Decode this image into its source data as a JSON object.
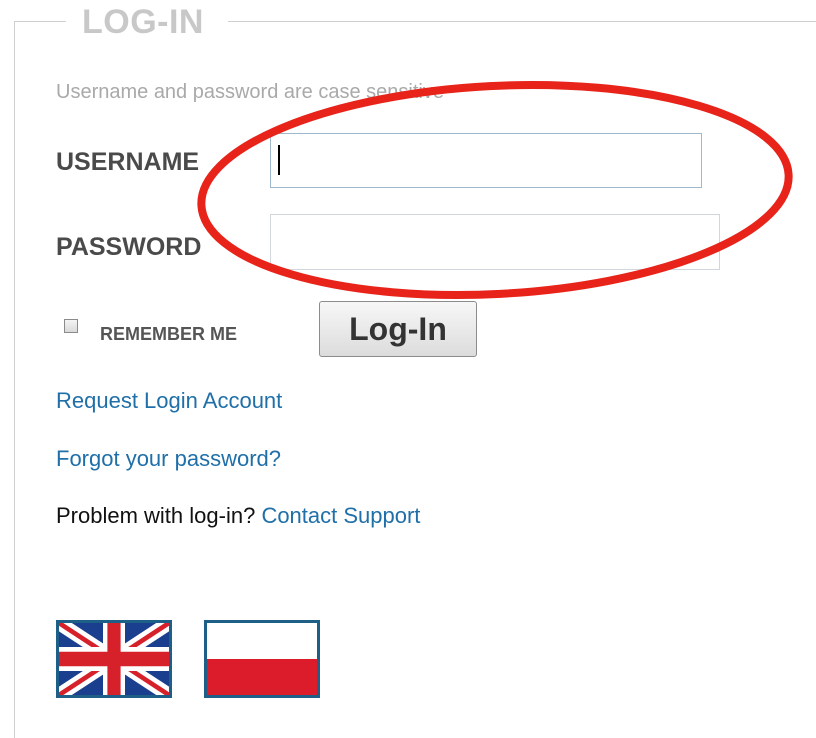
{
  "form": {
    "legend": "LOG-IN",
    "hint": "Username and password are case sensitive",
    "username_label": "USERNAME",
    "username_value": "",
    "password_label": "PASSWORD",
    "password_value": "",
    "remember_label": "REMEMBER ME",
    "remember_checked": false,
    "login_button": "Log-In"
  },
  "links": {
    "request_account": "Request Login Account",
    "forgot_password": "Forgot your password?",
    "problem_text": "Problem with log-in?",
    "contact_support": "Contact Support"
  },
  "languages": [
    {
      "name": "english-flag-icon"
    },
    {
      "name": "polish-flag-icon"
    }
  ],
  "colors": {
    "link": "#1f6fa8",
    "legend": "#c8c8c8",
    "annotation": "#e8231a",
    "flag_border": "#1d5f86"
  }
}
